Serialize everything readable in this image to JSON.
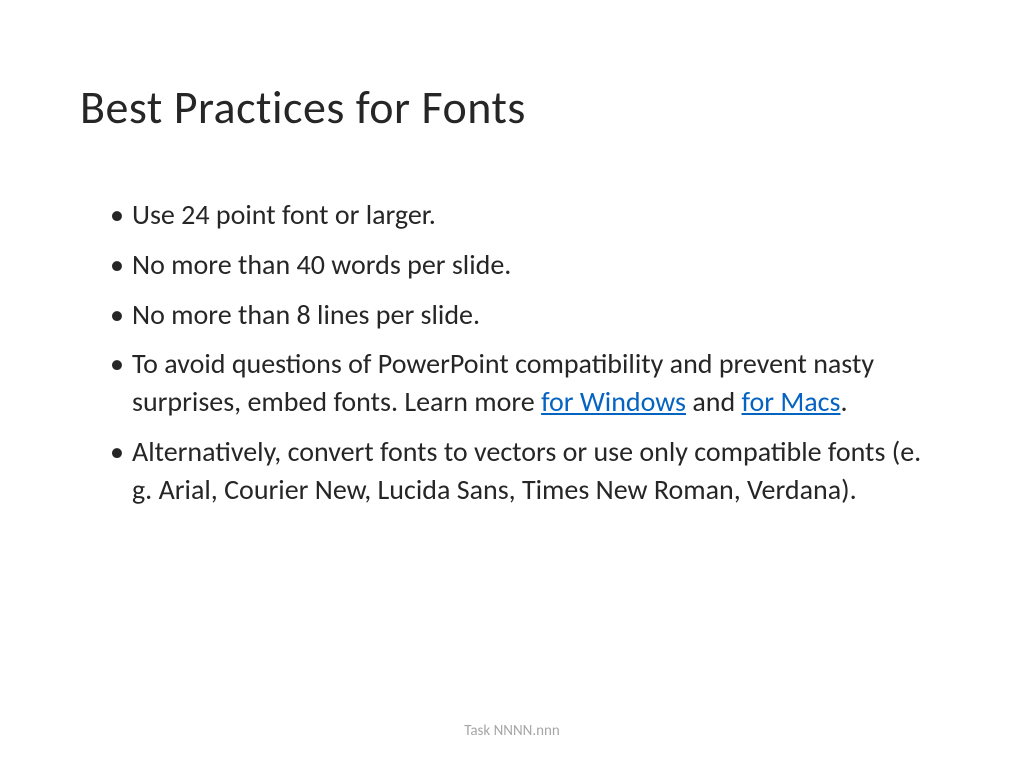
{
  "title": "Best Practices for Fonts",
  "bullets": [
    {
      "text": "Use 24 point font or larger."
    },
    {
      "text": "No more than 40 words per slide."
    },
    {
      "text": "No more than 8 lines per slide."
    },
    {
      "parts": [
        {
          "type": "text",
          "value": "To avoid questions of PowerPoint compatibility and prevent nasty surprises, embed fonts. Learn more "
        },
        {
          "type": "link",
          "value": "for Windows"
        },
        {
          "type": "text",
          "value": " and "
        },
        {
          "type": "link",
          "value": "for Macs"
        },
        {
          "type": "text",
          "value": "."
        }
      ]
    },
    {
      "text": "Alternatively, convert fonts to vectors or use only compatible fonts (e. g. Arial, Courier New, Lucida Sans, Times New Roman, Verdana)."
    }
  ],
  "footer": "Task NNNN.nnn"
}
